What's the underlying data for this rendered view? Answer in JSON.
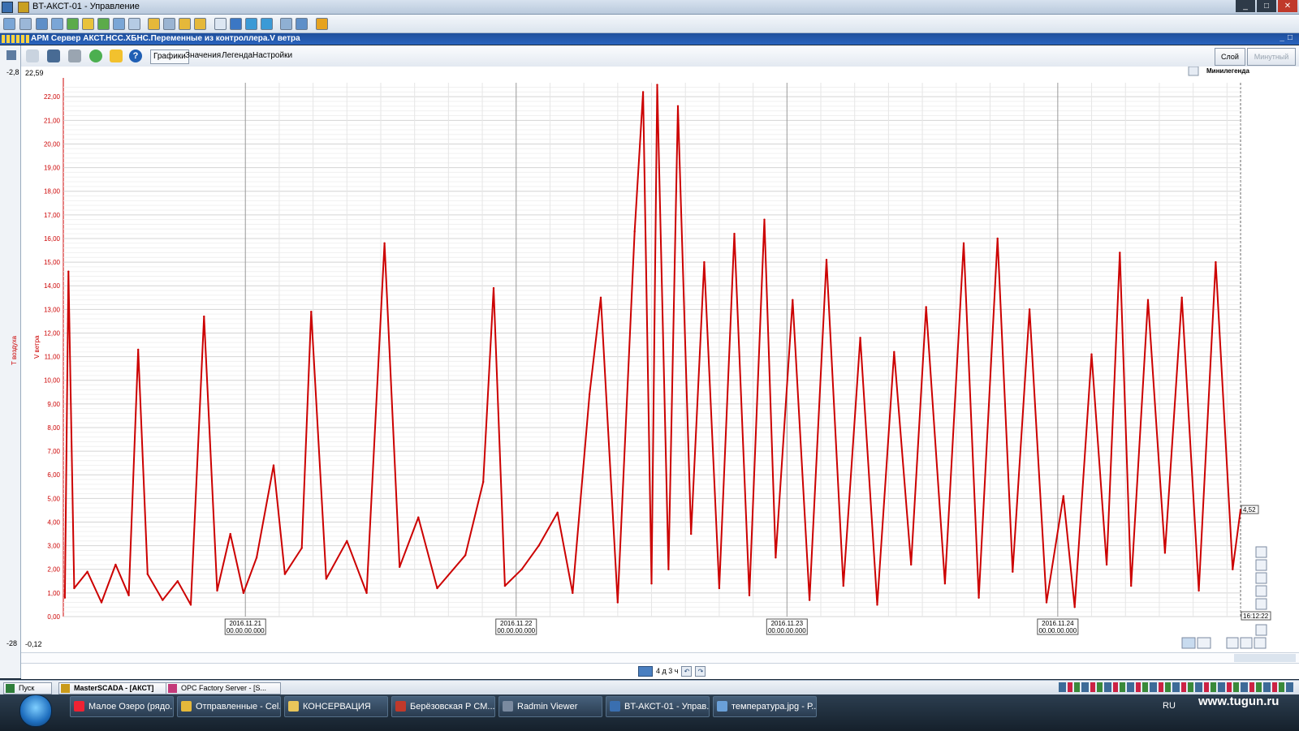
{
  "window": {
    "title": "BT-АКСТ-01 - Управление",
    "buttons": [
      "_",
      "□",
      "✕"
    ]
  },
  "document": {
    "title": "АРМ Сервер АКСТ.НСС.ХБНС.Переменные из контроллера.V ветра"
  },
  "trend_toolbar": {
    "tabs": [
      "Графики",
      "Значения",
      "Легенда",
      "Настройки"
    ],
    "active_tab": "Графики",
    "layer_button": "Слой",
    "mode_button": "Минутный",
    "minilegend_label": "Минилегенда"
  },
  "scale_labels": {
    "top_left": "-2,8",
    "top_value": "22,59",
    "bottom_left": "-28",
    "bottom_value": "-0,12",
    "current_value": "4,52",
    "end_time": "16:12:22",
    "axis_title_temp": "T воздуха",
    "axis_title_wind": "V ветра"
  },
  "navigation": {
    "range_label": "4 д 3 ч"
  },
  "app_taskbar": {
    "items": [
      {
        "label": "Пуск"
      },
      {
        "label": "MasterSCADA - [АКСТ]"
      },
      {
        "label": "OPC Factory Server - [S..."
      }
    ]
  },
  "os_taskbar": {
    "items": [
      {
        "label": "Малое Озеро (рядо..."
      },
      {
        "label": "Отправленные - Cel..."
      },
      {
        "label": "КОНСЕРВАЦИЯ"
      },
      {
        "label": "Берёзовская  Р  СМ..."
      },
      {
        "label": "Radmin Viewer"
      },
      {
        "label": "BT-АКСТ-01 - Управ..."
      },
      {
        "label": "температура.jpg - Р..."
      }
    ],
    "language": "RU",
    "watermark": "www.tugun.ru"
  },
  "colors": {
    "series": "#cc0000",
    "titlebar_doc": "#2a64bf"
  },
  "chart_data": {
    "type": "line",
    "ylim": [
      0,
      22.59
    ],
    "yticks": [
      "0,00",
      "1,00",
      "2,00",
      "3,00",
      "4,00",
      "5,00",
      "6,00",
      "7,00",
      "8,00",
      "9,00",
      "10,00",
      "11,00",
      "12,00",
      "13,00",
      "14,00",
      "15,00",
      "16,00",
      "17,00",
      "18,00",
      "19,00",
      "20,00",
      "21,00",
      "22,00"
    ],
    "xticks": [
      {
        "date": "2016.11.21",
        "time": "00.00.00.000"
      },
      {
        "date": "2016.11.22",
        "time": "00.00.00.000"
      },
      {
        "date": "2016.11.23",
        "time": "00.00.00.000"
      },
      {
        "date": "2016.11.24",
        "time": "00.00.00.000"
      }
    ],
    "x_start": "2016.11.20 07:52",
    "x_end": "2016.11.24 16:12:22",
    "grid": true,
    "series": [
      {
        "color": "#cc0000",
        "points": [
          [
            "2016.11.20 08:00",
            0.8
          ],
          [
            "2016.11.20 08:19",
            14.6
          ],
          [
            "2016.11.20 08:50",
            1.2
          ],
          [
            "2016.11.20 10:00",
            1.9
          ],
          [
            "2016.11.20 11:15",
            0.6
          ],
          [
            "2016.11.20 12:30",
            2.2
          ],
          [
            "2016.11.20 13:40",
            0.9
          ],
          [
            "2016.11.20 14:30",
            11.3
          ],
          [
            "2016.11.20 15:20",
            1.8
          ],
          [
            "2016.11.20 16:40",
            0.7
          ],
          [
            "2016.11.20 18:00",
            1.5
          ],
          [
            "2016.11.20 19:10",
            0.5
          ],
          [
            "2016.11.20 20:20",
            12.7
          ],
          [
            "2016.11.20 21:30",
            1.1
          ],
          [
            "2016.11.20 22:40",
            3.5
          ],
          [
            "2016.11.20 23:50",
            1.0
          ],
          [
            "2016.11.21 01:00",
            2.5
          ],
          [
            "2016.11.21 02:30",
            6.4
          ],
          [
            "2016.11.21 03:30",
            1.8
          ],
          [
            "2016.11.21 05:00",
            2.9
          ],
          [
            "2016.11.21 05:50",
            12.9
          ],
          [
            "2016.11.21 07:10",
            1.6
          ],
          [
            "2016.11.21 09:00",
            3.2
          ],
          [
            "2016.11.21 10:45",
            1.0
          ],
          [
            "2016.11.21 12:20",
            15.8
          ],
          [
            "2016.11.21 13:40",
            2.1
          ],
          [
            "2016.11.21 15:20",
            4.2
          ],
          [
            "2016.11.21 17:00",
            1.2
          ],
          [
            "2016.11.21 19:30",
            2.6
          ],
          [
            "2016.11.21 21:05",
            5.7
          ],
          [
            "2016.11.21 22:00",
            13.9
          ],
          [
            "2016.11.21 23:00",
            1.3
          ],
          [
            "2016.11.22 00:30",
            2.0
          ],
          [
            "2016.11.22 02:00",
            3.0
          ],
          [
            "2016.11.22 03:40",
            4.4
          ],
          [
            "2016.11.22 05:00",
            1.0
          ],
          [
            "2016.11.22 06:30",
            9.4
          ],
          [
            "2016.11.22 07:30",
            13.5
          ],
          [
            "2016.11.22 09:00",
            0.6
          ],
          [
            "2016.11.22 10:30",
            16.3
          ],
          [
            "2016.11.22 11:15",
            22.2
          ],
          [
            "2016.11.22 12:00",
            1.4
          ],
          [
            "2016.11.22 12:30",
            22.5
          ],
          [
            "2016.11.22 13:30",
            2.0
          ],
          [
            "2016.11.22 14:20",
            21.6
          ],
          [
            "2016.11.22 15:30",
            3.5
          ],
          [
            "2016.11.22 16:40",
            15.0
          ],
          [
            "2016.11.22 18:00",
            1.2
          ],
          [
            "2016.11.22 19:20",
            16.2
          ],
          [
            "2016.11.22 20:40",
            0.9
          ],
          [
            "2016.11.22 22:00",
            16.8
          ],
          [
            "2016.11.22 23:00",
            2.5
          ],
          [
            "2016.11.23 00:30",
            13.4
          ],
          [
            "2016.11.23 02:00",
            0.7
          ],
          [
            "2016.11.23 03:30",
            15.1
          ],
          [
            "2016.11.23 05:00",
            1.3
          ],
          [
            "2016.11.23 06:30",
            11.8
          ],
          [
            "2016.11.23 08:00",
            0.5
          ],
          [
            "2016.11.23 09:30",
            11.2
          ],
          [
            "2016.11.23 11:00",
            2.2
          ],
          [
            "2016.11.23 12:20",
            13.1
          ],
          [
            "2016.11.23 14:00",
            1.4
          ],
          [
            "2016.11.23 15:40",
            15.8
          ],
          [
            "2016.11.23 17:00",
            0.8
          ],
          [
            "2016.11.23 18:40",
            16.0
          ],
          [
            "2016.11.23 20:00",
            1.9
          ],
          [
            "2016.11.23 21:30",
            13.0
          ],
          [
            "2016.11.23 23:00",
            0.6
          ],
          [
            "2016.11.24 00:30",
            5.1
          ],
          [
            "2016.11.24 01:30",
            0.4
          ],
          [
            "2016.11.24 03:00",
            11.1
          ],
          [
            "2016.11.24 04:20",
            2.2
          ],
          [
            "2016.11.24 05:30",
            15.4
          ],
          [
            "2016.11.24 06:30",
            1.3
          ],
          [
            "2016.11.24 08:00",
            13.4
          ],
          [
            "2016.11.24 09:30",
            2.7
          ],
          [
            "2016.11.24 11:00",
            13.5
          ],
          [
            "2016.11.24 12:30",
            1.1
          ],
          [
            "2016.11.24 14:00",
            15.0
          ],
          [
            "2016.11.24 15:30",
            2.0
          ],
          [
            "2016.11.24 16:12",
            4.52
          ]
        ]
      }
    ]
  }
}
